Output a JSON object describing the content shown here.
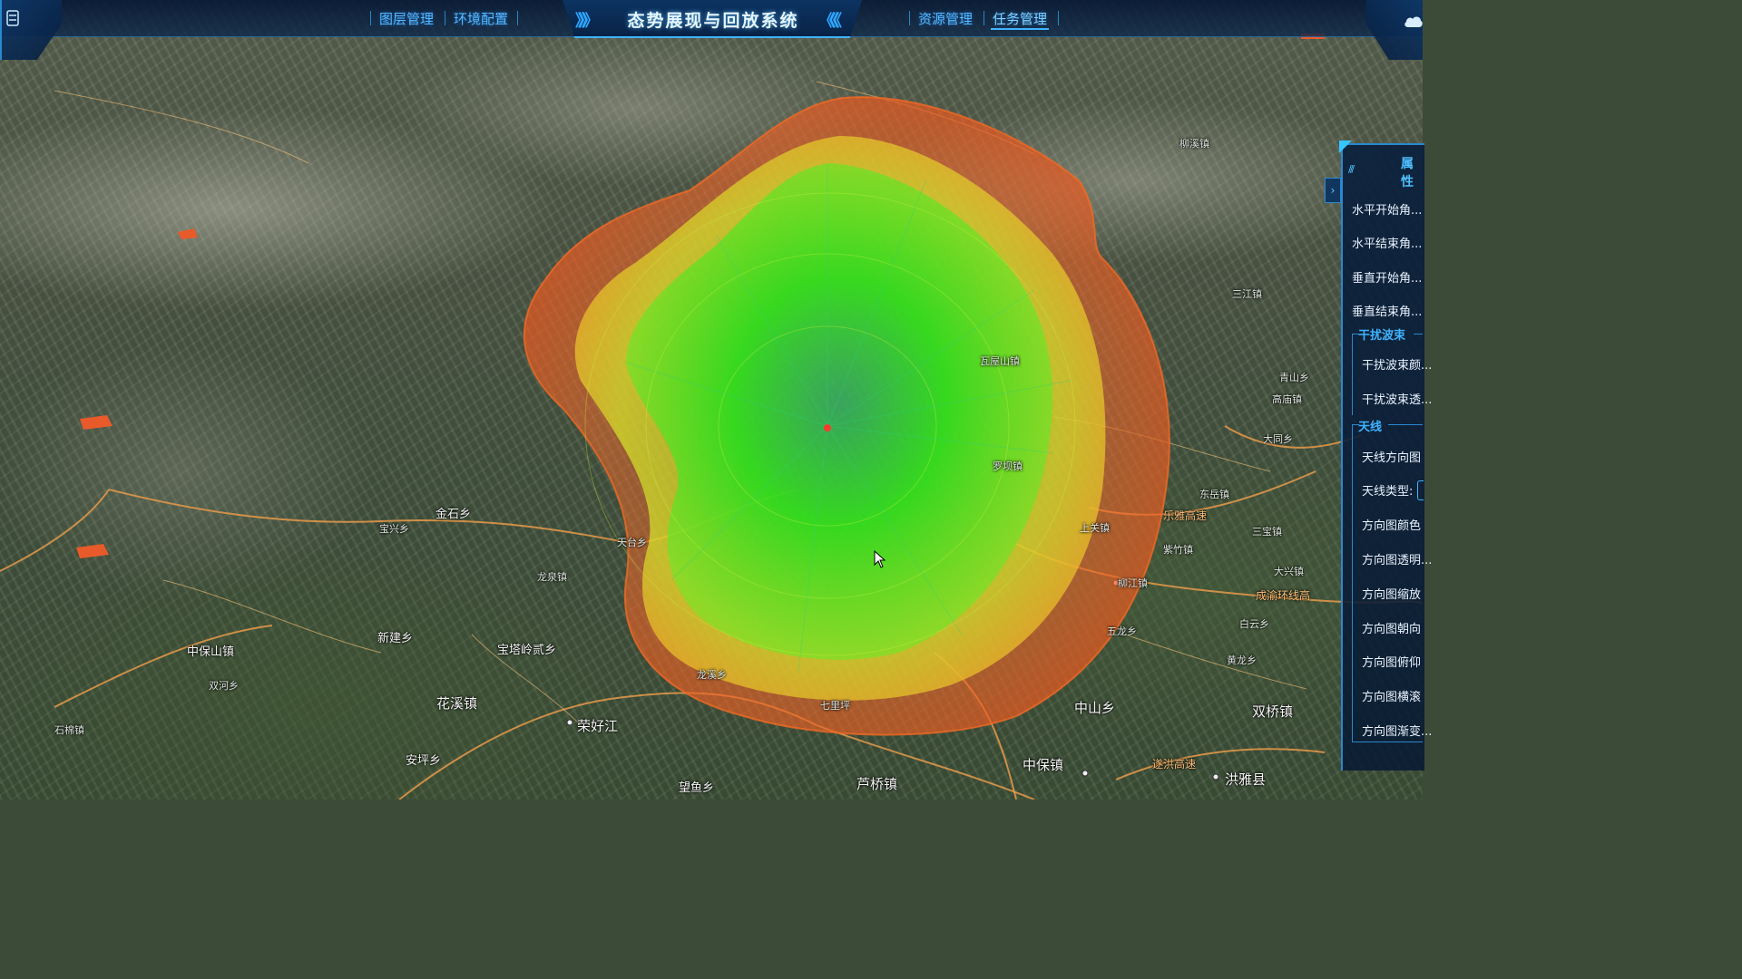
{
  "header": {
    "title": "态势展现与回放系统",
    "nav_left": [
      "图层管理",
      "环境配置"
    ],
    "nav_right": [
      "资源管理",
      "任务管理"
    ],
    "active_nav": "任务管理",
    "left_chevrons": "》》》",
    "right_chevrons": "《《《"
  },
  "property_panel": {
    "title": "属性",
    "collapse_icon": "›",
    "rows_top": [
      "水平开始角...",
      "水平结束角...",
      "垂直开始角...",
      "垂直结束角..."
    ],
    "section_jamming": {
      "label": "干扰波束",
      "rows": [
        "干扰波束颜...",
        "干扰波束透..."
      ]
    },
    "section_antenna": {
      "label": "天线",
      "rows": [
        "天线方向图",
        "天线类型:",
        "方向图颜色",
        "方向图透明...",
        "方向图缩放",
        "方向图朝向",
        "方向图俯仰",
        "方向图横滚",
        "方向图渐变..."
      ]
    }
  },
  "map_labels": {
    "c1": "花溪镇",
    "c2": "安坪乡",
    "c3": "荣好江",
    "c4": "新建乡",
    "c5": "宝塔岭贰乡",
    "c6": "中山乡",
    "c7": "双桥镇",
    "c8": "中保镇",
    "c9": "洪雅县",
    "c10": "芦桥镇",
    "c11": "望鱼乡",
    "c12": "紫竹镇",
    "c13": "五龙乡",
    "c14": "柳江镇",
    "c15": "三宝镇",
    "c16": "大兴镇",
    "c17": "东岳镇",
    "c18": "白云乡",
    "c19": "黄龙乡",
    "c20": "中保山镇",
    "c21": "石棉镇",
    "c22": "双河乡",
    "c23": "金石乡",
    "c24": "宝兴乡",
    "c25": "天台乡",
    "c26": "大同乡",
    "c27": "龙泉镇",
    "c28": "上关镇",
    "c29": "遂洪高速",
    "c30": "成渝环线高",
    "c31": "乐雅高速",
    "c32": "高庙镇",
    "c33": "罗坝镇",
    "c34": "青山乡",
    "c35": "三江镇",
    "c36": "柳溪镇",
    "c37": "瓦屋山镇",
    "c38": "七里坪",
    "c39": "龙溪乡"
  },
  "colors": {
    "accent": "#3fb4ff",
    "beam_core": "#22e01c",
    "beam_mid": "#d6e82a",
    "beam_edge": "#ef6a2a",
    "road": "#e79a4a"
  },
  "icons": {
    "menu": "menu-icon",
    "cloud": "cloud-icon",
    "cursor": "cursor-icon"
  }
}
